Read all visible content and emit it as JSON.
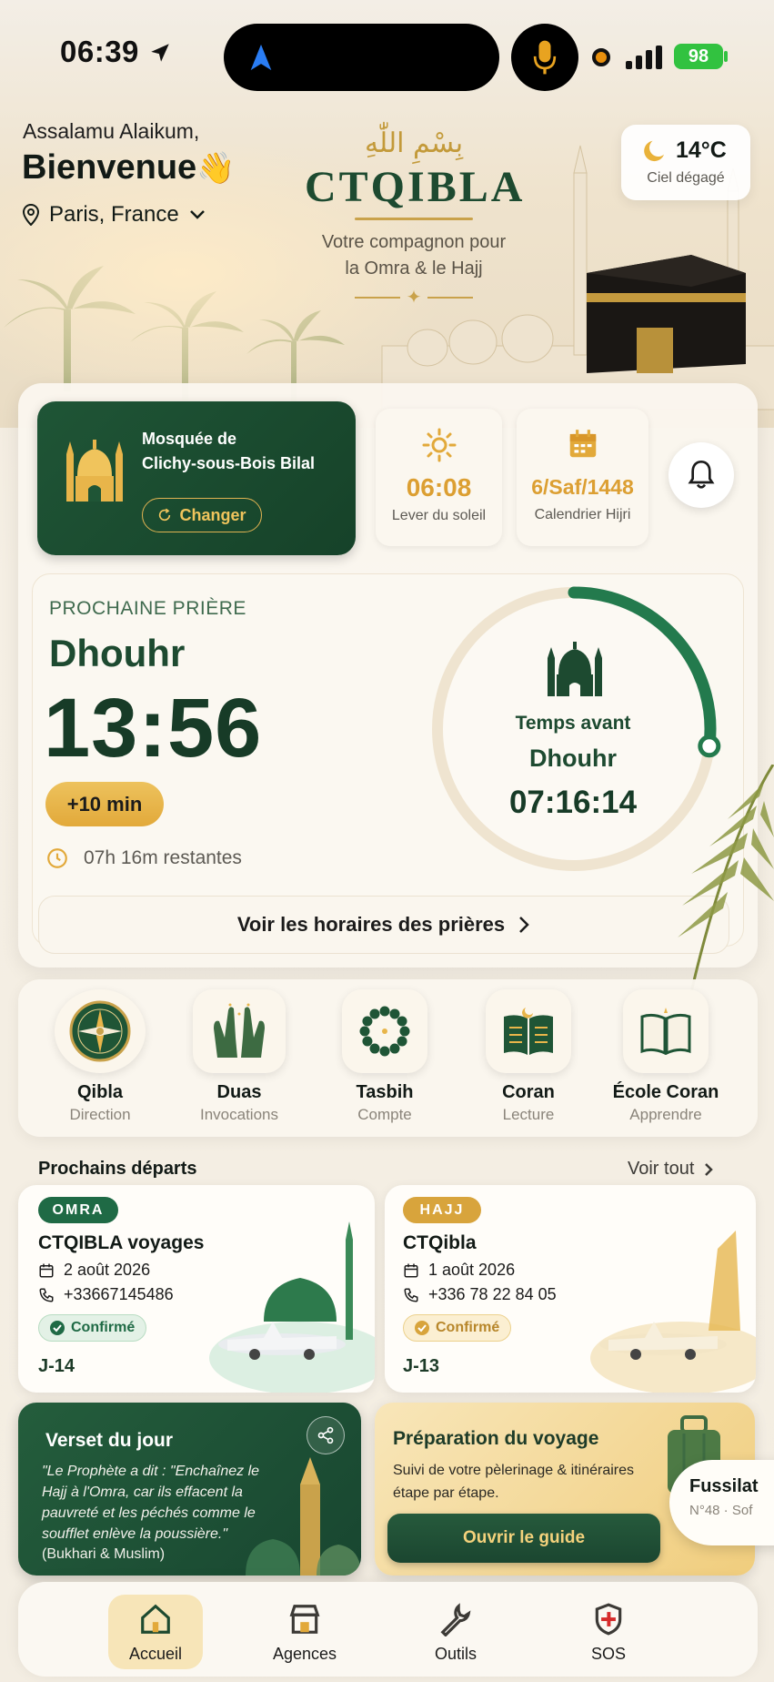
{
  "status_bar": {
    "time": "06:39",
    "battery": "98"
  },
  "header": {
    "greeting": "Assalamu Alaikum,",
    "welcome": "Bienvenue",
    "welcome_emoji": "👋",
    "location": "Paris, France"
  },
  "brand": {
    "arabic": "بِسْمِ اللّٰهِ",
    "name": "CTQIBLA",
    "tagline_line1": "Votre compagnon pour",
    "tagline_line2": "la Omra & le Hajj"
  },
  "weather": {
    "temperature": "14°C",
    "condition": "Ciel dégagé"
  },
  "mosque": {
    "name_line1": "Mosquée de",
    "name_line2": "Clichy-sous-Bois Bilal",
    "change_label": "Changer"
  },
  "sunrise": {
    "time": "06:08",
    "label": "Lever du soleil"
  },
  "hijri": {
    "date": "6/Saf/1448",
    "label": "Calendrier Hijri"
  },
  "next_prayer": {
    "heading": "PROCHAINE PRIÈRE",
    "name": "Dhouhr",
    "time": "13:56",
    "offset": "+10 min",
    "remaining": "07h 16m restantes",
    "countdown_label": "Temps avant",
    "countdown_prayer": "Dhouhr",
    "countdown": "07:16:14",
    "progress_fraction": 0.27,
    "view_times_label": "Voir les horaires des prières"
  },
  "features": [
    {
      "label": "Qibla",
      "sub": "Direction",
      "icon": "compass-icon"
    },
    {
      "label": "Duas",
      "sub": "Invocations",
      "icon": "praying-hands-icon"
    },
    {
      "label": "Tasbih",
      "sub": "Compte",
      "icon": "prayer-beads-icon"
    },
    {
      "label": "Coran",
      "sub": "Lecture",
      "icon": "quran-icon"
    },
    {
      "label": "École Coran",
      "sub": "Apprendre",
      "icon": "open-book-icon"
    }
  ],
  "departures": {
    "title": "Prochains départs",
    "see_all": "Voir tout",
    "items": [
      {
        "tag": "OMRA",
        "agency": "CTQIBLA voyages",
        "date": "2 août 2026",
        "phone": "+33667145486",
        "status": "Confirmé",
        "countdown": "J-14",
        "color": "#1f6a45"
      },
      {
        "tag": "HAJJ",
        "agency": "CTQibla",
        "date": "1 août 2026",
        "phone": "+336 78 22 84 05",
        "status": "Confirmé",
        "countdown": "J-13",
        "color": "#d8a43c"
      }
    ]
  },
  "verse": {
    "title": "Verset du jour",
    "text": "\"Le Prophète a dit : \"Enchaînez le Hajj à l'Omra, car ils effacent la pauvreté et les péchés comme le soufflet enlève la poussière.\"",
    "source": "(Bukhari & Muslim)"
  },
  "preparation": {
    "title": "Préparation du voyage",
    "text": "Suivi de votre pèlerinage & itinéraires étape par étape.",
    "button": "Ouvrir le guide"
  },
  "surah_popup": {
    "name": "Fussilat",
    "detail": "N°48 · Sof"
  },
  "tabs": [
    {
      "label": "Accueil",
      "icon": "home-icon"
    },
    {
      "label": "Agences",
      "icon": "store-icon"
    },
    {
      "label": "Outils",
      "icon": "wrench-icon"
    },
    {
      "label": "SOS",
      "icon": "shield-plus-icon"
    }
  ],
  "colors": {
    "primary_green": "#1d4a30",
    "gold": "#d9a33b",
    "background": "#f3ede2"
  }
}
